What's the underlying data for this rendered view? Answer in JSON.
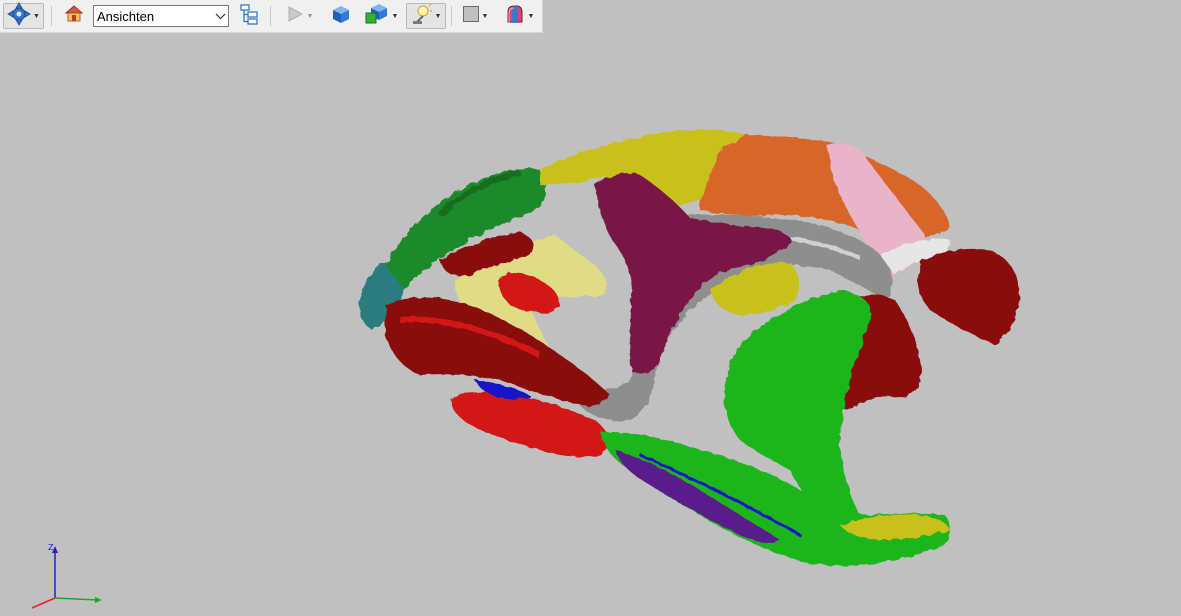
{
  "toolbar": {
    "navigate_icon": "navigate-crosshair-icon",
    "home_icon": "home-icon",
    "views_select": {
      "value": "Ansichten",
      "icon": "chevron-down-icon"
    },
    "model_tree_icon": "model-tree-icon",
    "play_icon": "play-icon",
    "cube_icon": "solid-cube-icon",
    "render_mode_icon": "render-mode-cubes-icon",
    "lighting_icon": "lighting-lamp-icon",
    "background_icon": "background-color-icon",
    "cross_section_icon": "cross-section-icon"
  },
  "viewport": {
    "background": "#c0c0c0",
    "model": "3D skull model with colored bone segments",
    "axes": {
      "z_label": "Z",
      "colors": {
        "x": "#1fa81f",
        "y": "#e52020",
        "z": "#2020d0"
      }
    }
  },
  "colors": {
    "yellow": "#c9c01a",
    "orange": "#d8662a",
    "pink": "#e9b4c8",
    "maroon": "#7a1244",
    "gray": "#8e8e8e",
    "dark_red": "#8a0c0c",
    "red": "#d31818",
    "green": "#1fb61f",
    "dark_green": "#1f8a2a",
    "pale_yellow": "#e0dc86",
    "teal": "#2c7c7e",
    "blue": "#1818c8",
    "purple": "#5a1a8a",
    "white": "#e6e6e6"
  }
}
